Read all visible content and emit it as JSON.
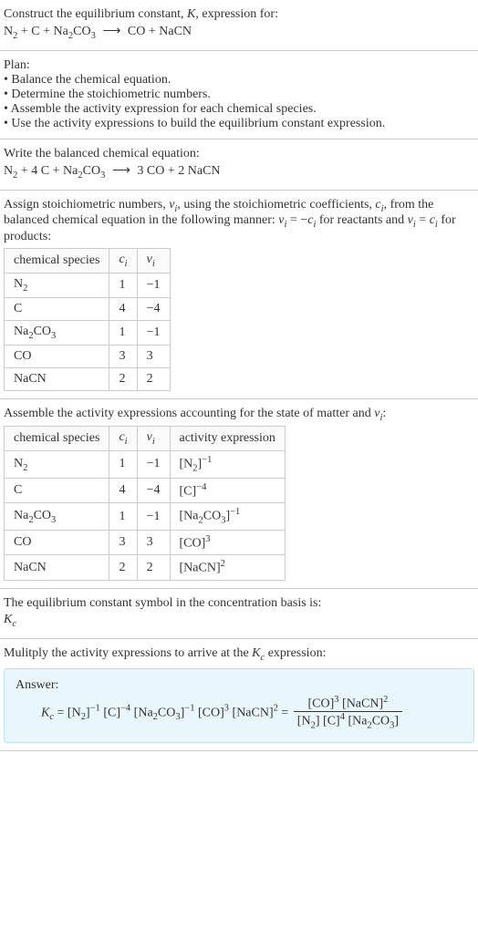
{
  "s1": {
    "line1": "Construct the equilibrium constant, ",
    "K": "K",
    "line1b": ", expression for:"
  },
  "s2": {
    "title": "Plan:",
    "b1": "• Balance the chemical equation.",
    "b2": "• Determine the stoichiometric numbers.",
    "b3": "• Assemble the activity expression for each chemical species.",
    "b4": "• Use the activity expressions to build the equilibrium constant expression."
  },
  "s3": {
    "title": "Write the balanced chemical equation:"
  },
  "s4": {
    "p1a": "Assign stoichiometric numbers, ",
    "nu_i": "ν",
    "p1b": ", using the stoichiometric coefficients, ",
    "c_i": "c",
    "p1c": ", from the balanced chemical equation in the following manner: ",
    "rel1a": "ν",
    "rel1b": " = −",
    "rel1c": "c",
    "p1d": " for reactants and ",
    "rel2a": "ν",
    "rel2b": " = ",
    "rel2c": "c",
    "p1e": " for products:",
    "h1": "chemical species",
    "h2": "c",
    "h3": "ν",
    "rows": [
      {
        "sp": "N",
        "spsub": "2",
        "c": "1",
        "v": "−1"
      },
      {
        "sp": "C",
        "spsub": "",
        "c": "4",
        "v": "−4"
      },
      {
        "sp": "Na",
        "spsub": "2",
        "sp2": "CO",
        "sp2sub": "3",
        "c": "1",
        "v": "−1"
      },
      {
        "sp": "CO",
        "spsub": "",
        "c": "3",
        "v": "3"
      },
      {
        "sp": "NaCN",
        "spsub": "",
        "c": "2",
        "v": "2"
      }
    ]
  },
  "s5": {
    "p": "Assemble the activity expressions accounting for the state of matter and ",
    "nu": "ν",
    "colon": ":",
    "h1": "chemical species",
    "h2": "c",
    "h3": "ν",
    "h4": "activity expression"
  },
  "s6": {
    "p1": "The equilibrium constant symbol in the concentration basis is:",
    "K": "K",
    "c": "c"
  },
  "s7": {
    "p1": "Mulitply the activity expressions to arrive at the ",
    "K": "K",
    "c": "c",
    "p2": " expression:",
    "ans": "Answer:"
  },
  "sym": {
    "N2": "N",
    "sub2": "2",
    "C": "C",
    "Na2CO3_a": "Na",
    "Na2CO3_b": "CO",
    "sub3": "3",
    "CO": "CO",
    "NaCN": "NaCN",
    "plus": " + ",
    "arrow": "⟶",
    "coef4": "4 ",
    "coef3": "3 ",
    "coef2": "2 ",
    "lb": "[",
    "rb": "]",
    "m1": "−1",
    "m4": "−4",
    "p3": "3",
    "p2": "2",
    "p4": "4",
    "i": "i",
    "eq": " = "
  },
  "chart_data": {
    "type": "table",
    "tables": [
      {
        "columns": [
          "chemical species",
          "c_i",
          "ν_i"
        ],
        "rows": [
          [
            "N2",
            1,
            -1
          ],
          [
            "C",
            4,
            -4
          ],
          [
            "Na2CO3",
            1,
            -1
          ],
          [
            "CO",
            3,
            3
          ],
          [
            "NaCN",
            2,
            2
          ]
        ]
      },
      {
        "columns": [
          "chemical species",
          "c_i",
          "ν_i",
          "activity expression"
        ],
        "rows": [
          [
            "N2",
            1,
            -1,
            "[N2]^-1"
          ],
          [
            "C",
            4,
            -4,
            "[C]^-4"
          ],
          [
            "Na2CO3",
            1,
            -1,
            "[Na2CO3]^-1"
          ],
          [
            "CO",
            3,
            3,
            "[CO]^3"
          ],
          [
            "NaCN",
            2,
            2,
            "[NaCN]^2"
          ]
        ]
      }
    ]
  }
}
